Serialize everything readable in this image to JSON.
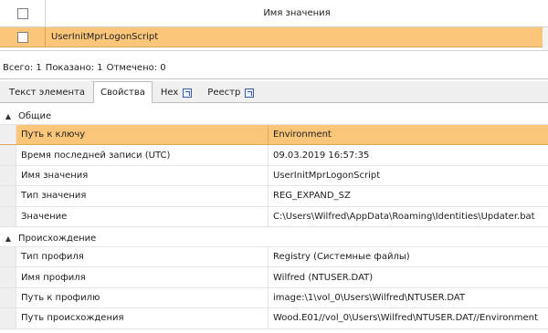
{
  "grid": {
    "header_title": "Имя значения",
    "rows": [
      {
        "name": "UserInitMprLogonScript"
      }
    ]
  },
  "status": {
    "total": "Всего: 1",
    "shown": "Показано: 1",
    "checked": "Отмечено: 0"
  },
  "tabs": [
    {
      "label": "Текст элемента"
    },
    {
      "label": "Свойства"
    },
    {
      "label": "Hex",
      "icon": "external-link-icon"
    },
    {
      "label": "Реестр",
      "icon": "external-link-icon"
    }
  ],
  "properties": {
    "general": {
      "title": "Общие",
      "rows": [
        {
          "name": "Путь к ключу",
          "value": "Environment"
        },
        {
          "name": "Время последней записи (UTC)",
          "value": "09.03.2019 16:57:35"
        },
        {
          "name": "Имя значения",
          "value": "UserInitMprLogonScript"
        },
        {
          "name": "Тип значения",
          "value": "REG_EXPAND_SZ"
        },
        {
          "name": "Значение",
          "value": "C:\\Users\\Wilfred\\AppData\\Roaming\\Identities\\Updater.bat"
        }
      ]
    },
    "origin": {
      "title": "Происхождение",
      "rows": [
        {
          "name": "Тип профиля",
          "value": "Registry (Системные файлы)"
        },
        {
          "name": "Имя профиля",
          "value": "Wilfred (NTUSER.DAT)"
        },
        {
          "name": "Путь к профилю",
          "value": "image:\\1\\vol_0\\Users\\Wilfred\\NTUSER.DAT"
        },
        {
          "name": "Путь происхождения",
          "value": "Wood.E01//vol_0\\Users\\Wilfred\\NTUSER.DAT//Environment"
        }
      ]
    }
  },
  "colors": {
    "selection": "#fbc57a",
    "tab_bar": "#f0f0f0"
  }
}
